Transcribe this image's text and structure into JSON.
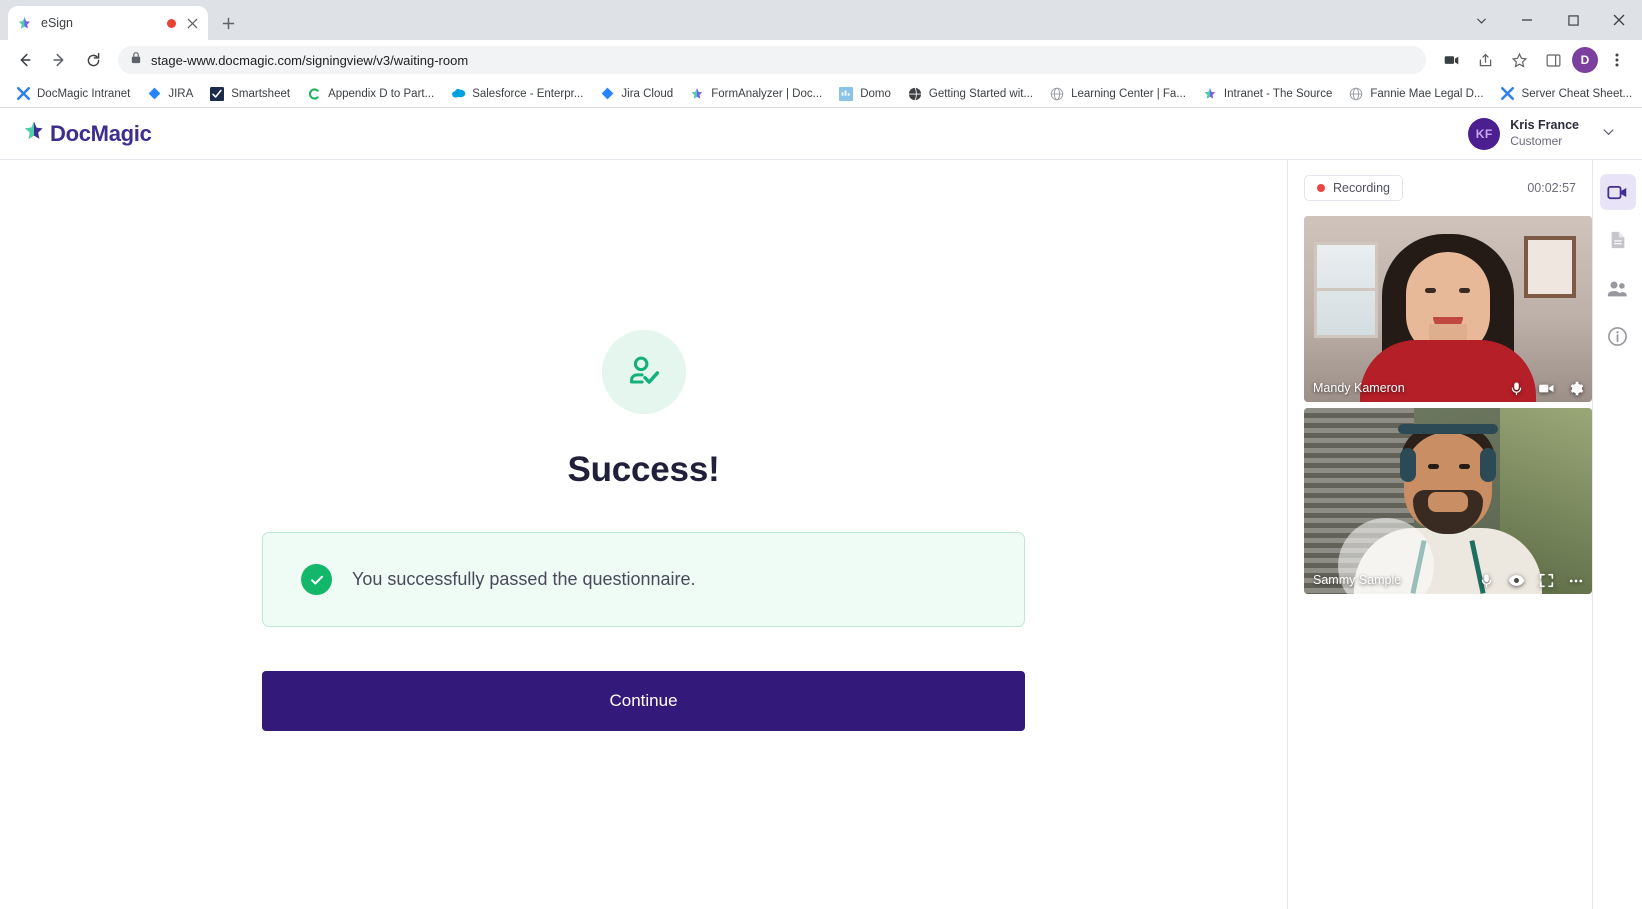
{
  "browser": {
    "tab": {
      "title": "eSign",
      "favicon": "docmagic-star-icon",
      "recording_indicator": "recording-dot-icon",
      "close": "close-icon"
    },
    "new_tab_label": "+",
    "window_controls": [
      "chevron-down-icon",
      "minimize-icon",
      "maximize-icon",
      "close-icon"
    ],
    "nav": {
      "back": "back-arrow-icon",
      "forward": "forward-arrow-icon",
      "reload": "reload-icon"
    },
    "omnibox": {
      "lock": "lock-icon",
      "url": "stage-www.docmagic.com/signingview/v3/waiting-room"
    },
    "toolbar_icons": [
      "media-cast-icon",
      "share-icon",
      "star-icon",
      "sidepanel-icon"
    ],
    "profile_initial": "D",
    "menu": "kebab-menu-icon",
    "bookmarks": [
      {
        "label": "DocMagic Intranet",
        "icon": "docmagic-x-icon",
        "color": "#2f80ed"
      },
      {
        "label": "JIRA",
        "icon": "jira-diamond-icon",
        "color": "#2684ff"
      },
      {
        "label": "Smartsheet",
        "icon": "smartsheet-check-icon",
        "color": "#1a2b4c"
      },
      {
        "label": "Appendix D to Part...",
        "icon": "c-letter-icon",
        "color": "#1fb25a"
      },
      {
        "label": "Salesforce - Enterpr...",
        "icon": "salesforce-cloud-icon",
        "color": "#00a1e0"
      },
      {
        "label": "Jira Cloud",
        "icon": "jira-diamond-icon",
        "color": "#2684ff"
      },
      {
        "label": "FormAnalyzer | Doc...",
        "icon": "docmagic-star-icon",
        "color": "#7b5cf0"
      },
      {
        "label": "Domo",
        "icon": "domo-square-icon",
        "color": "#89c4e8"
      },
      {
        "label": "Getting Started wit...",
        "icon": "globe-dark-icon",
        "color": "#3c4043"
      },
      {
        "label": "Learning Center | Fa...",
        "icon": "globe-icon",
        "color": "#9aa0a6"
      },
      {
        "label": "Intranet - The Source",
        "icon": "docmagic-star-icon",
        "color": "#7b5cf0"
      },
      {
        "label": "Fannie Mae Legal D...",
        "icon": "globe-icon",
        "color": "#9aa0a6"
      },
      {
        "label": "Server Cheat Sheet...",
        "icon": "docmagic-x-icon",
        "color": "#2f80ed"
      },
      {
        "label": "",
        "icon": "salesforce-cloud-icon",
        "color": "#00a1e0"
      }
    ]
  },
  "app": {
    "brand": {
      "name": "DocMagic",
      "logo": "docmagic-star-logo",
      "color": "#3d2f8f"
    },
    "user": {
      "initials": "KF",
      "name": "Kris France",
      "role": "Customer",
      "caret": "chevron-down-icon"
    }
  },
  "main": {
    "status_icon": "person-check-icon",
    "title": "Success!",
    "alert": {
      "icon": "check-circle-icon",
      "message": "You successfully passed the questionnaire.",
      "color": "#12b76a"
    },
    "continue_label": "Continue",
    "continue_color": "#331a7a"
  },
  "video": {
    "recording_label": "Recording",
    "recording_dot_color": "#ef4444",
    "timer": "00:02:57",
    "tiles": [
      {
        "name": "Mandy Kameron",
        "controls": [
          "microphone-icon",
          "camera-icon",
          "gear-icon"
        ]
      },
      {
        "name": "Sammy Sample",
        "controls": [
          "microphone-icon",
          "eye-icon",
          "fullscreen-icon",
          "more-options-icon"
        ]
      }
    ]
  },
  "rail": {
    "items": [
      {
        "icon": "video-camera-icon",
        "active": true
      },
      {
        "icon": "document-icon",
        "active": false
      },
      {
        "icon": "participants-icon",
        "active": false
      },
      {
        "icon": "info-icon",
        "active": false
      }
    ]
  }
}
